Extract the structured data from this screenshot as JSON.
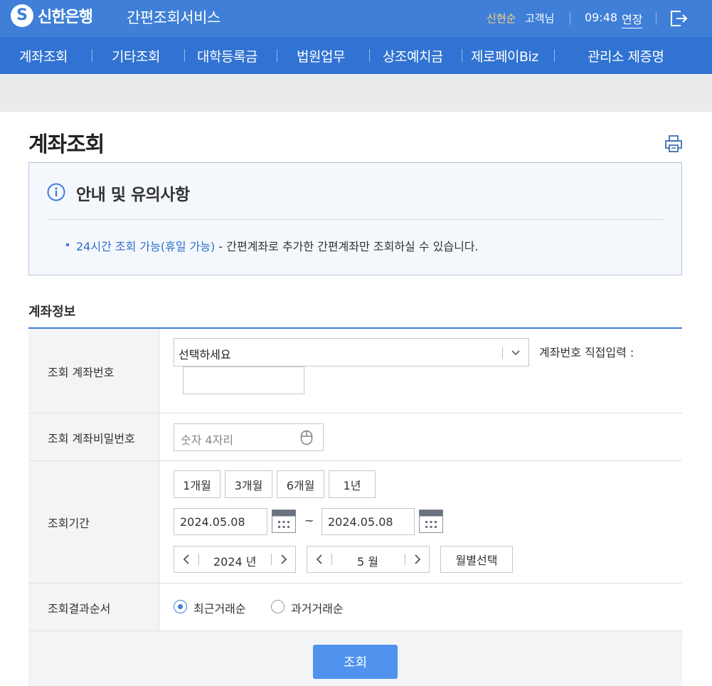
{
  "header": {
    "logo_text": "신한은행",
    "service_title": "간편조회서비스",
    "user_name": "신현순",
    "user_suffix": "고객님",
    "session_time": "09:48",
    "extend_label": "연장"
  },
  "nav": {
    "items": [
      "계좌조회",
      "기타조회",
      "대학등록금",
      "법원업무",
      "상조예치금",
      "제로페이Biz",
      "관리소 제증명"
    ]
  },
  "page": {
    "title": "계좌조회"
  },
  "notice": {
    "title": "안내 및 유의사항",
    "highlight": "24시간 조회 가능(휴일 가능)",
    "text": " - 간편계좌로 추가한 간편계좌만 조회하실 수 있습니다."
  },
  "form": {
    "section_title": "계좌정보",
    "account_label": "조회 계좌번호",
    "account_select_value": "선택하세요",
    "direct_input_label": "계좌번호 직접입력 :",
    "direct_input_value": "",
    "password_label": "조회 계좌비밀번호",
    "password_placeholder": "숫자 4자리",
    "period_label": "조회기간",
    "period_buttons": [
      "1개월",
      "3개월",
      "6개월",
      "1년"
    ],
    "start_date": "2024.05.08",
    "date_separator": "~",
    "end_date": "2024.05.08",
    "year_value": "2024 년",
    "month_value": "5 월",
    "month_select_label": "월별선택",
    "order_label": "조회결과순서",
    "order_options": [
      "최근거래순",
      "과거거래순"
    ],
    "order_selected": "최근거래순",
    "submit_label": "조회"
  },
  "colors": {
    "topbar": "#3f7fd8",
    "nav": "#3173d2",
    "accent": "#4f93ee",
    "user_name": "#ffd37a"
  }
}
